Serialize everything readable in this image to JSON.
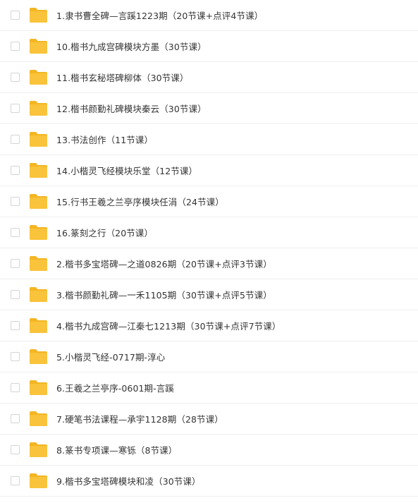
{
  "colors": {
    "folder_body": "#f9c33b",
    "folder_tab": "#f3b623",
    "text": "#333333",
    "divider": "#efefef",
    "checkbox_border": "#d4d4d4"
  },
  "files": [
    {
      "name": "1.隶书曹全碑—言蹊1223期（20节课+点评4节课）",
      "icon": "folder-icon"
    },
    {
      "name": "10.楷书九成宫碑模块方墨（30节课）",
      "icon": "folder-icon"
    },
    {
      "name": "11.楷书玄秘塔碑柳体（30节课）",
      "icon": "folder-icon"
    },
    {
      "name": "12.楷书颜勤礼碑模块秦云（30节课）",
      "icon": "folder-icon"
    },
    {
      "name": "13.书法创作（11节课）",
      "icon": "folder-icon"
    },
    {
      "name": "14.小楷灵飞经模块乐堂（12节课）",
      "icon": "folder-icon"
    },
    {
      "name": "15.行书王羲之兰亭序模块任涓（24节课）",
      "icon": "folder-icon"
    },
    {
      "name": "16.篆刻之行（20节课）",
      "icon": "folder-icon"
    },
    {
      "name": "2.楷书多宝塔碑—之道0826期（20节课+点评3节课）",
      "icon": "folder-icon"
    },
    {
      "name": "3.楷书颜勤礼碑—一禾1105期（30节课+点评5节课）",
      "icon": "folder-icon"
    },
    {
      "name": "4.楷书九成宫碑—江秦七1213期（30节课+点评7节课）",
      "icon": "folder-icon"
    },
    {
      "name": "5.小楷灵飞经-0717期-淳心",
      "icon": "folder-icon"
    },
    {
      "name": "6.王羲之兰亭序-0601期-言蹊",
      "icon": "folder-icon"
    },
    {
      "name": "7.硬笔书法课程—承宇1128期（28节课）",
      "icon": "folder-icon"
    },
    {
      "name": "8.篆书专项课—寒铄（8节课）",
      "icon": "folder-icon"
    },
    {
      "name": "9.楷书多宝塔碑模块和凌（30节课）",
      "icon": "folder-icon"
    }
  ]
}
